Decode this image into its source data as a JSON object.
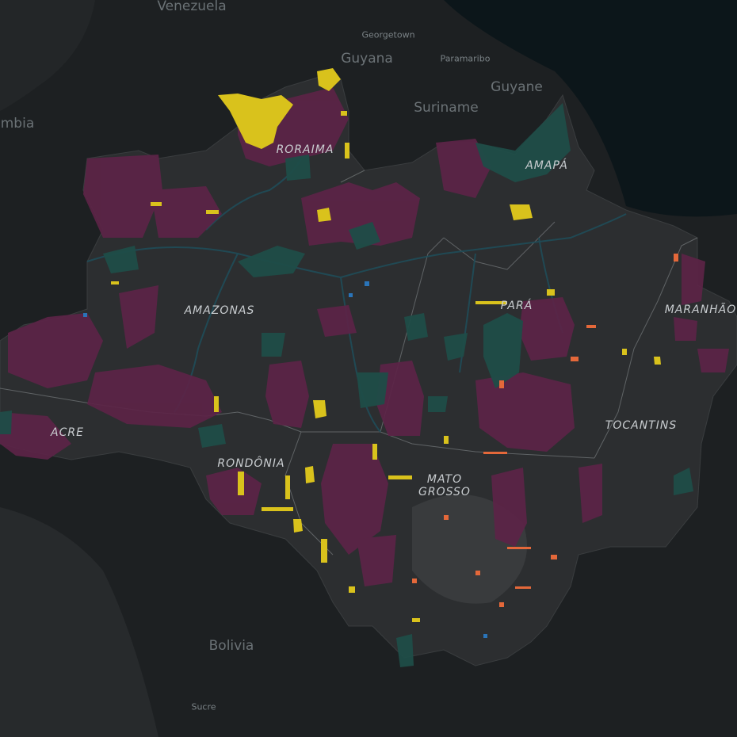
{
  "map": {
    "countries": {
      "venezuela": "Venezuela",
      "guyana": "Guyana",
      "suriname": "Suriname",
      "guyane": "Guyane",
      "colombia": "mbia",
      "bolivia": "Bolivia"
    },
    "cities": {
      "georgetown": "Georgetown",
      "paramaribo": "Paramaribo",
      "sucre": "Sucre"
    },
    "states": {
      "roraima": "RORAIMA",
      "amapa": "AMAPÁ",
      "amazonas": "AMAZONAS",
      "para": "PARÁ",
      "maranhao": "MARANHÃO",
      "acre": "ACRE",
      "rondonia": "RONDÔNIA",
      "tocantins": "TOCANTINS",
      "mato_grosso_line1": "MATO",
      "mato_grosso_line2": "GROSSO"
    },
    "colors": {
      "ocean": "#0b1417",
      "land_outside": "#1c1f21",
      "amazon_region": "#2b2d2f",
      "indigenous_land": "#5a2345",
      "protected_area": "#1f4b47",
      "mining": "#d8c21a",
      "deforestation": "#e4683a",
      "rivers": "#1d4a55",
      "borders": "#8a8f92"
    }
  }
}
